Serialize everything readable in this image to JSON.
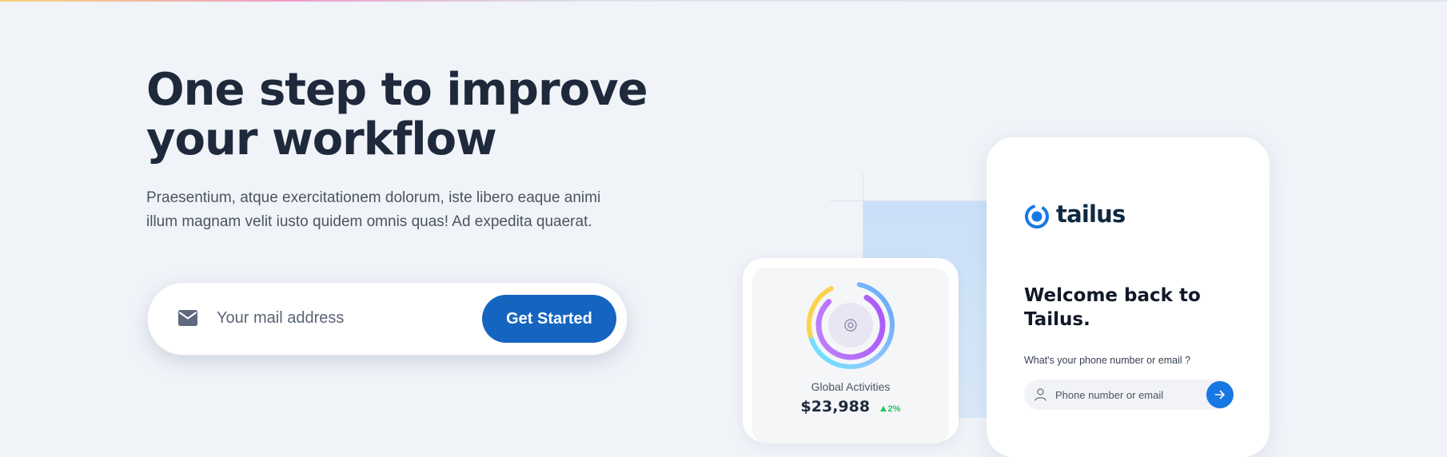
{
  "hero": {
    "title_line1": "One step to improve",
    "title_line2": "your workflow",
    "description": "Praesentium, atque exercitationem dolorum, iste libero eaque animi illum magnam velit iusto quidem omnis quas! Ad expedita quaerat."
  },
  "signup": {
    "icon": "mail-icon",
    "placeholder": "Your mail address",
    "button_label": "Get Started"
  },
  "activity_card": {
    "icon": "target-icon",
    "label": "Global Activities",
    "value": "$23,988",
    "change": "2%",
    "change_icon": "triangle-up-icon"
  },
  "login_card": {
    "logo_icon": "tailus-logo-icon",
    "brand": "tailus",
    "welcome": "Welcome back to Tailus.",
    "question": "What's your phone number or email ?",
    "input_icon": "user-icon",
    "input_placeholder": "Phone number or email",
    "submit_icon": "arrow-right-icon"
  },
  "colors": {
    "background": "#f0f3f8",
    "primary_button": "#1565c0",
    "accent_blue": "#1778e4",
    "heading": "#1e293b",
    "positive": "#22c55e"
  }
}
